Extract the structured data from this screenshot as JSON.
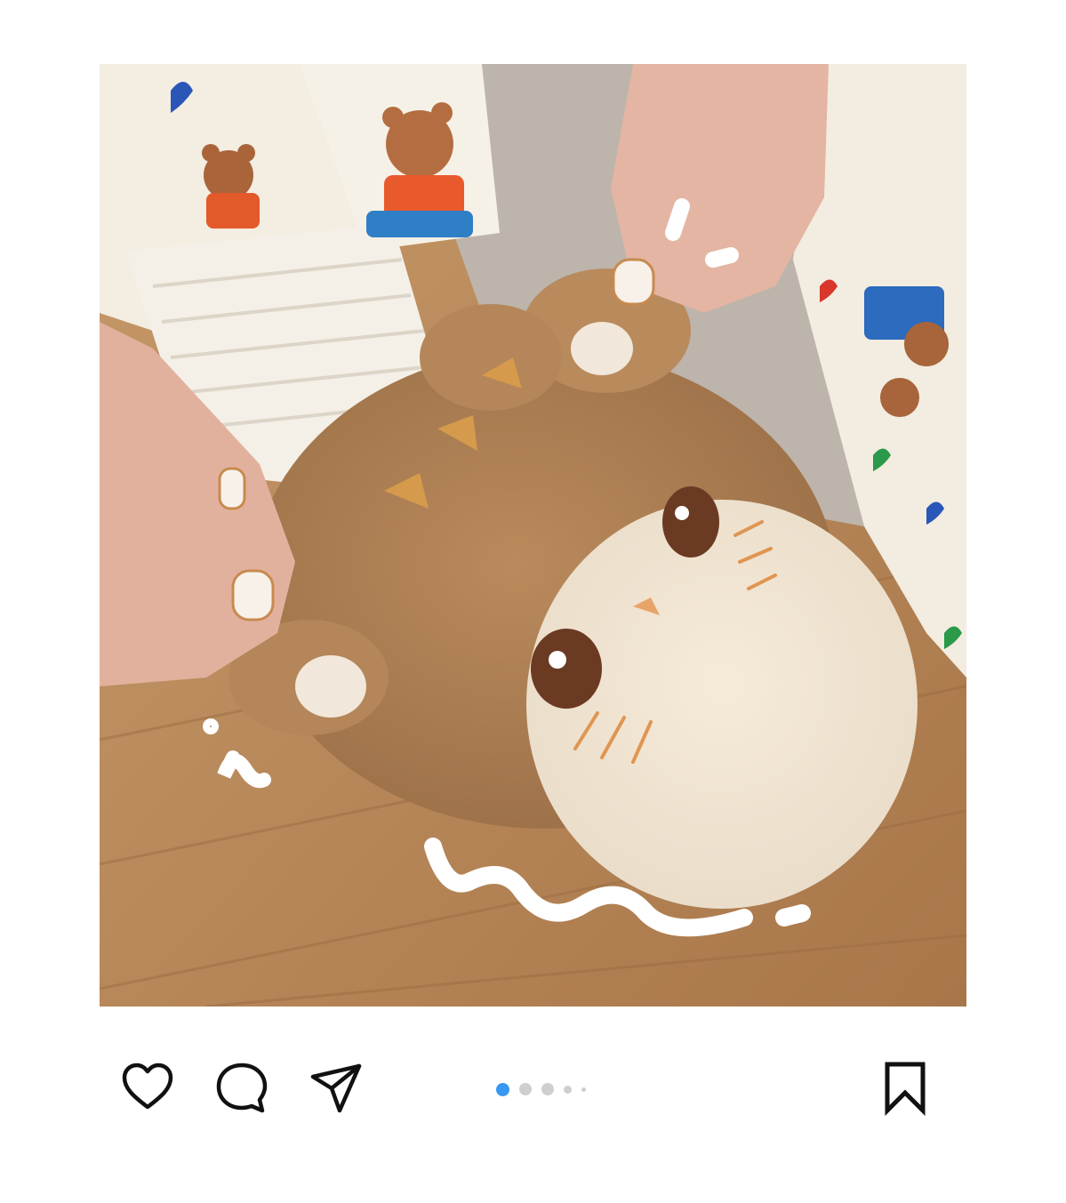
{
  "post": {
    "image_description_icon": "photo",
    "carousel": {
      "total": 5,
      "active_index": 0,
      "active_color": "#3897f0",
      "inactive_color": "#cfcfcf"
    }
  },
  "actions": {
    "like_icon": "heart-icon",
    "comment_icon": "comment-bubble-icon",
    "share_icon": "paper-plane-icon",
    "save_icon": "bookmark-icon"
  },
  "colors": {
    "icon_stroke": "#111111",
    "background": "#ffffff"
  }
}
